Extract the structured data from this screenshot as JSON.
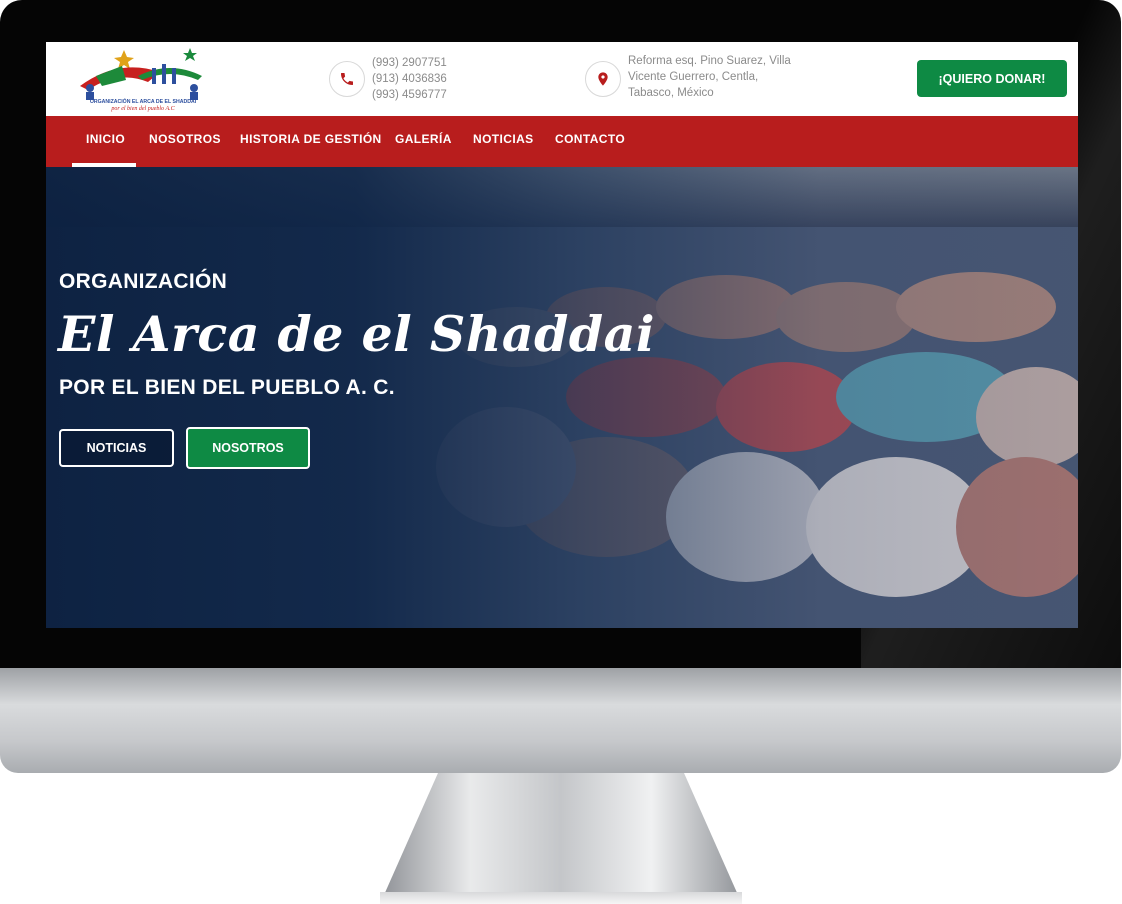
{
  "header": {
    "logo_text": "ORGANIZACIÓN EL ARCA DE EL SHADDAI",
    "logo_tagline": "por el bien del pueblo A.C",
    "phones": [
      "(993) 2907751",
      "(913) 4036836",
      "(993) 4596777"
    ],
    "address_lines": [
      "Reforma esq. Pino Suarez, Villa",
      "Vicente Guerrero, Centla,",
      "Tabasco, México"
    ],
    "donate_label": "¡QUIERO DONAR!"
  },
  "nav": {
    "items": [
      "INICIO",
      "NOSOTROS",
      "HISTORIA DE GESTIÓN",
      "GALERÍA",
      "NOTICIAS",
      "CONTACTO"
    ],
    "active": "INICIO"
  },
  "hero": {
    "pre_title": "ORGANIZACIÓN",
    "title": "El Arca de el Shaddai",
    "subtitle": "POR EL BIEN DEL PUEBLO A. C.",
    "buttons": [
      "NOTICIAS",
      "NOSOTROS"
    ]
  },
  "colors": {
    "nav_red": "#b81d1d",
    "donate_green": "#0e8a44",
    "hero_navy": "#0b2040"
  },
  "icons": [
    "phone-icon",
    "location-pin-icon"
  ]
}
